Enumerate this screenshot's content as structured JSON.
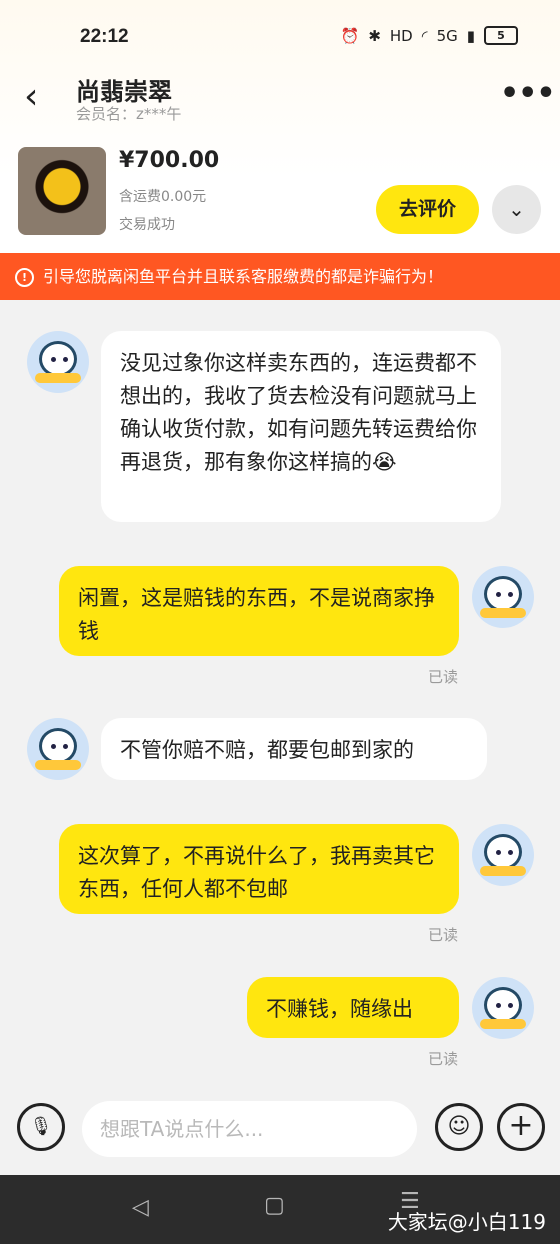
{
  "status_bar": {
    "time": "22:12",
    "network": "5G",
    "hd": "HD",
    "battery": "5"
  },
  "header": {
    "title": "尚翡崇翠",
    "member": "会员名：z***午"
  },
  "product": {
    "price": "¥700.00",
    "shipping": "含运费0.00元",
    "status": "交易成功",
    "review_button": "去评价"
  },
  "warning": {
    "text": "引导您脱离闲鱼平台并且联系客服缴费的都是诈骗行为！"
  },
  "messages": [
    {
      "from": "other",
      "text": "没见过象你这样卖东西的，连运费都不想出的，我收了货去检没有问题就马上确认收货付款，如有问题先转运费给你再退货，那有象你这样搞的😭"
    },
    {
      "from": "me",
      "text": "闲置，这是赔钱的东西，不是说商家挣钱",
      "read": "已读"
    },
    {
      "from": "other",
      "text": "不管你赔不赔，都要包邮到家的"
    },
    {
      "from": "me",
      "text": "这次算了，不再说什么了，我再卖其它东西，任何人都不包邮",
      "read": "已读"
    },
    {
      "from": "me",
      "text": "不赚钱，随缘出",
      "read": "已读"
    }
  ],
  "input": {
    "placeholder": "想跟TA说点什么..."
  },
  "nav": {
    "back": "◁",
    "home": "▢",
    "recent": "☰"
  },
  "watermark": "大家坛@小白119",
  "colors": {
    "accent": "#ffe60f",
    "warning": "#ff5722"
  }
}
